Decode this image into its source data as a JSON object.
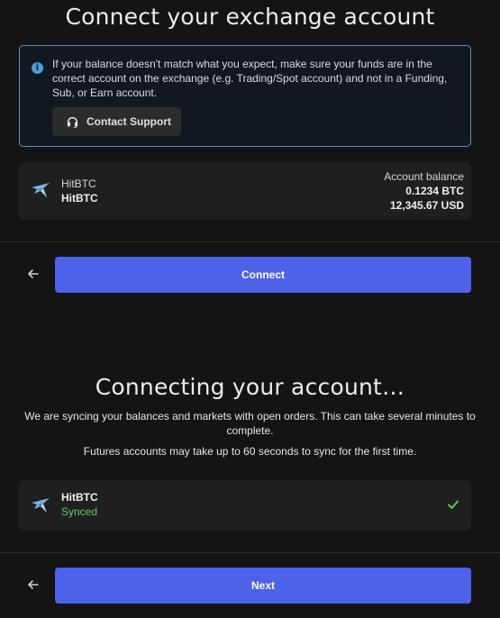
{
  "connect_section": {
    "title": "Connect your exchange account",
    "info_text": "If your balance doesn't match what you expect, make sure your funds are in the correct account on the exchange (e.g. Trading/Spot account) and not in a Funding, Sub, or Earn account.",
    "support_button": "Contact Support",
    "exchange": {
      "name_top": "HitBTC",
      "name_bold": "HitBTC",
      "balance_label": "Account balance",
      "balance_btc": "0.1234 BTC",
      "balance_usd": "12,345.67 USD"
    },
    "connect_button": "Connect"
  },
  "connecting_section": {
    "title": "Connecting your account…",
    "description": "We are syncing your balances and markets with open orders. This can take several minutes to complete.",
    "futures_note": "Futures accounts may take up to 60 seconds to sync for the first time.",
    "exchange": {
      "name": "HitBTC",
      "status": "Synced"
    },
    "next_button": "Next"
  },
  "colors": {
    "accent": "#4d62e8",
    "success": "#5dd46a",
    "info": "#4a9ee0"
  },
  "icons": [
    "info-icon",
    "headset-icon",
    "hitbtc-logo-icon",
    "back-arrow-icon",
    "check-icon"
  ]
}
